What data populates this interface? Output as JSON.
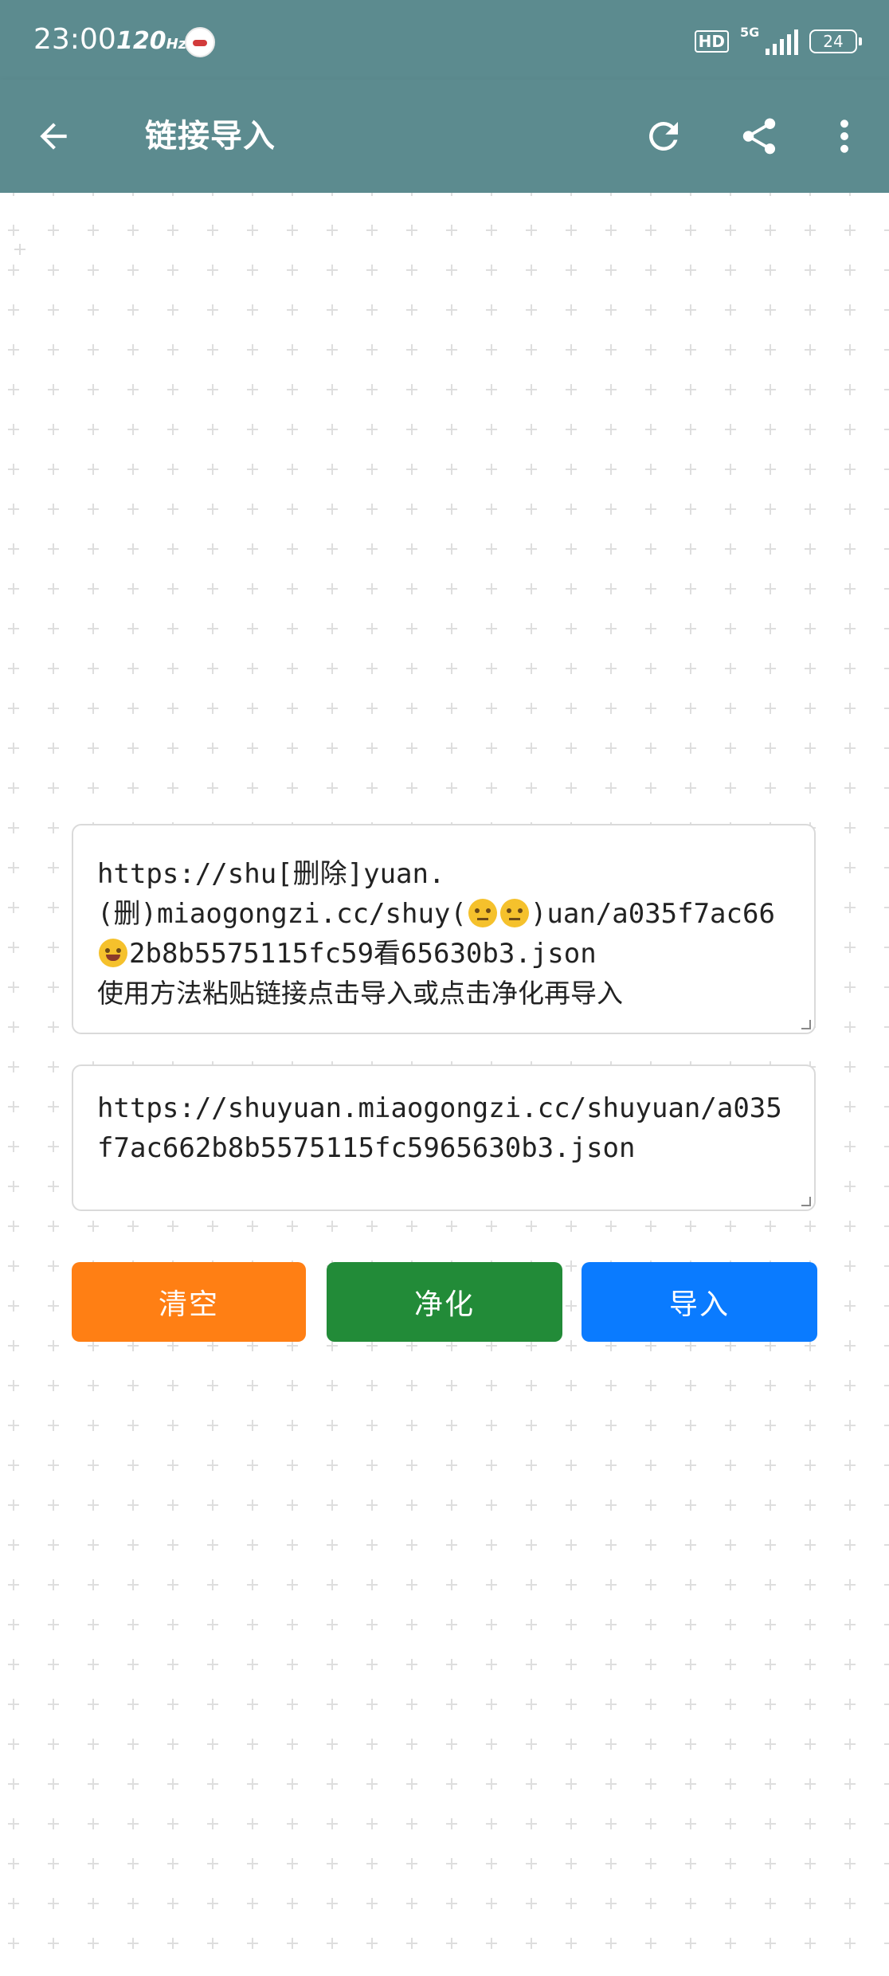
{
  "status_bar": {
    "time": "23:00",
    "refresh_rate": "120",
    "hd_badge": "HD",
    "network": "5G",
    "battery": "24"
  },
  "app_bar": {
    "title": "链接导入",
    "icons": [
      "back-arrow-icon",
      "refresh-icon",
      "share-icon",
      "more-vert-icon"
    ]
  },
  "source_input": {
    "line1": "https://shu[删除]yuan.",
    "line2_start": "(删)miaogongzi.cc/shuy(",
    "line2_end": ")uan/a035f7ac66",
    "line3": "2b8b5575115fc59看65630b3.json",
    "hint": "使用方法粘贴链接点击导入或点击净化再导入"
  },
  "result_input": {
    "value": "https://shuyuan.miaogongzi.cc/shuyuan/a035f7ac662b8b5575115fc5965630b3.json"
  },
  "buttons": {
    "clear": "清空",
    "clean": "净化",
    "import": "导入"
  },
  "colors": {
    "app_bar": "#5c8b8f",
    "clear_button": "#ff7f14",
    "clean_button": "#228b38",
    "import_button": "#0a7bff"
  }
}
